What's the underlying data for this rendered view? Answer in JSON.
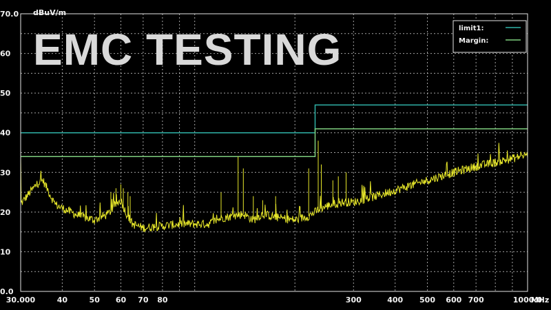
{
  "overlay_text": "EMC TESTING",
  "chart_data": {
    "type": "line",
    "ylabel": "dBuV/m",
    "xunit": "MHz",
    "xscale": "log",
    "xlim": [
      30,
      1000
    ],
    "ylim": [
      0,
      70
    ],
    "grid": true,
    "legend_position": "top-right",
    "x_tick_labels": [
      {
        "value": 30,
        "label": "30.000"
      },
      {
        "value": 40,
        "label": "40"
      },
      {
        "value": 50,
        "label": "50"
      },
      {
        "value": 60,
        "label": "60"
      },
      {
        "value": 70,
        "label": "70"
      },
      {
        "value": 80,
        "label": "80"
      },
      {
        "value": 300,
        "label": "300"
      },
      {
        "value": 400,
        "label": "400"
      },
      {
        "value": 500,
        "label": "500"
      },
      {
        "value": 600,
        "label": "600"
      },
      {
        "value": 700,
        "label": "700"
      },
      {
        "value": 1000,
        "label": "1000.0"
      }
    ],
    "y_tick_labels": [
      {
        "value": 0,
        "label": "0.0"
      },
      {
        "value": 10,
        "label": "10"
      },
      {
        "value": 20,
        "label": "20"
      },
      {
        "value": 30,
        "label": "30"
      },
      {
        "value": 40,
        "label": "40"
      },
      {
        "value": 50,
        "label": "50"
      },
      {
        "value": 60,
        "label": "60"
      },
      {
        "value": 70,
        "label": "70.0"
      }
    ],
    "series": [
      {
        "name": "limit1:",
        "color": "#2fb3a8",
        "step": true,
        "points": [
          [
            30,
            40
          ],
          [
            230,
            40
          ],
          [
            230,
            47
          ],
          [
            1000,
            47
          ]
        ]
      },
      {
        "name": "Margin:",
        "color": "#7fd07f",
        "step": true,
        "points": [
          [
            30,
            34
          ],
          [
            230,
            34
          ],
          [
            230,
            41
          ],
          [
            1000,
            41
          ]
        ]
      },
      {
        "color": "#e8e82a",
        "style": "noisy",
        "points": [
          [
            30,
            22
          ],
          [
            32,
            25
          ],
          [
            34,
            27.5
          ],
          [
            35,
            28
          ],
          [
            36,
            26
          ],
          [
            38,
            22
          ],
          [
            40,
            21
          ],
          [
            45,
            19
          ],
          [
            50,
            18
          ],
          [
            55,
            19.5
          ],
          [
            58,
            22
          ],
          [
            60,
            23
          ],
          [
            62,
            20
          ],
          [
            65,
            17
          ],
          [
            70,
            16
          ],
          [
            80,
            16.5
          ],
          [
            90,
            17
          ],
          [
            100,
            17
          ],
          [
            110,
            17
          ],
          [
            120,
            18.5
          ],
          [
            130,
            19
          ],
          [
            140,
            19.5
          ],
          [
            150,
            18
          ],
          [
            160,
            19.5
          ],
          [
            180,
            18.5
          ],
          [
            200,
            18
          ],
          [
            220,
            19
          ],
          [
            240,
            21
          ],
          [
            260,
            22
          ],
          [
            280,
            22.5
          ],
          [
            300,
            22.5
          ],
          [
            350,
            24
          ],
          [
            400,
            25.5
          ],
          [
            500,
            28
          ],
          [
            600,
            30
          ],
          [
            700,
            31.5
          ],
          [
            800,
            32.5
          ],
          [
            900,
            33.5
          ],
          [
            1000,
            34.5
          ]
        ],
        "spikes": [
          [
            33,
            27
          ],
          [
            56,
            25
          ],
          [
            58,
            26
          ],
          [
            60,
            27
          ],
          [
            61,
            26
          ],
          [
            63,
            25
          ],
          [
            64,
            24
          ],
          [
            120,
            25
          ],
          [
            135,
            34
          ],
          [
            140,
            31
          ],
          [
            150,
            24
          ],
          [
            160,
            23
          ],
          [
            175,
            24
          ],
          [
            220,
            31
          ],
          [
            235,
            38
          ],
          [
            240,
            32
          ],
          [
            260,
            28
          ],
          [
            270,
            29
          ],
          [
            285,
            30
          ]
        ]
      }
    ]
  }
}
